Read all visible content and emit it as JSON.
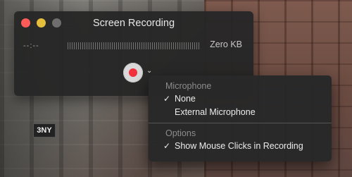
{
  "window": {
    "title": "Screen Recording",
    "time": "--:--",
    "size": "Zero KB",
    "record_icon": "record-dot-icon",
    "menu_icon": "chevron-down-icon",
    "chevron": "⌄"
  },
  "menu": {
    "section_microphone": "Microphone",
    "mic_none": "None",
    "mic_external": "External Microphone",
    "section_options": "Options",
    "show_clicks": "Show Mouse Clicks in Recording",
    "checkmark": "✓"
  },
  "background": {
    "sign": "3NY"
  },
  "colors": {
    "close": "#fc5b57",
    "minimize": "#e5bf3c",
    "maximize": "#6e6e6e",
    "record": "#f2313c"
  }
}
